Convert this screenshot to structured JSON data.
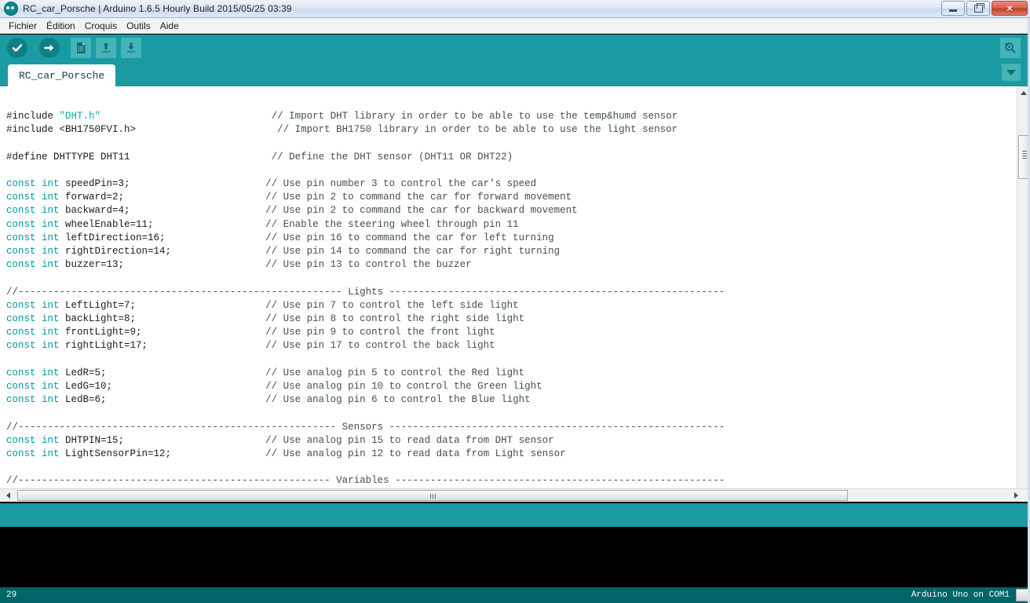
{
  "window": {
    "title": "RC_car_Porsche | Arduino 1.6.5 Hourly Build 2015/05/25 03:39",
    "logo_icon": "arduino-infinity-icon",
    "minimize_icon": "minimize-icon",
    "maximize_icon": "maximize-restore-icon",
    "close_icon": "close-icon",
    "close_glyph": "×"
  },
  "menu": {
    "items": [
      {
        "label": "Fichier"
      },
      {
        "label": "Édition"
      },
      {
        "label": "Croquis"
      },
      {
        "label": "Outils"
      },
      {
        "label": "Aide"
      }
    ]
  },
  "toolbar": {
    "verify_label": "Vérifier",
    "upload_label": "Téléverser",
    "new_label": "Nouveau",
    "open_label": "Ouvrir",
    "save_label": "Enregistrer",
    "serial_monitor_label": "Moniteur série",
    "icons": [
      "check-icon",
      "arrow-right-icon",
      "new-file-icon",
      "open-folder-icon",
      "save-icon",
      "serial-monitor-icon"
    ]
  },
  "tabs": {
    "active": "RC_car_Porsche",
    "items": [
      {
        "label": "RC_car_Porsche"
      }
    ],
    "dropdown_icon": "chevron-down-icon"
  },
  "editor": {
    "lines": [
      [
        {
          "t": "pre",
          "v": "#include "
        },
        {
          "t": "str",
          "v": "\"DHT.h\""
        },
        {
          "t": "pre",
          "v": "                             "
        },
        {
          "t": "cm",
          "v": "// Import DHT library in order to be able to use the temp&humd sensor"
        }
      ],
      [
        {
          "t": "pre",
          "v": "#include <BH1750FVI.h>"
        },
        {
          "t": "pre",
          "v": "                        "
        },
        {
          "t": "cm",
          "v": "// Import BH1750 library in order to be able to use the light sensor"
        }
      ],
      [
        {
          "t": "pre",
          "v": ""
        }
      ],
      [
        {
          "t": "pre",
          "v": "#define DHTTYPE DHT11"
        },
        {
          "t": "pre",
          "v": "                        "
        },
        {
          "t": "cm",
          "v": "// Define the DHT sensor (DHT11 OR DHT22)"
        }
      ],
      [
        {
          "t": "pre",
          "v": ""
        }
      ],
      [
        {
          "t": "kw",
          "v": "const int"
        },
        {
          "t": "pre",
          "v": " speedPin=3;"
        },
        {
          "t": "pre",
          "v": "                       "
        },
        {
          "t": "cm",
          "v": "// Use pin number 3 to control the car's speed"
        }
      ],
      [
        {
          "t": "kw",
          "v": "const int"
        },
        {
          "t": "pre",
          "v": " forward=2;"
        },
        {
          "t": "pre",
          "v": "                        "
        },
        {
          "t": "cm",
          "v": "// Use pin 2 to command the car for forward movement"
        }
      ],
      [
        {
          "t": "kw",
          "v": "const int"
        },
        {
          "t": "pre",
          "v": " backward=4;"
        },
        {
          "t": "pre",
          "v": "                       "
        },
        {
          "t": "cm",
          "v": "// Use pin 2 to command the car for backward movement"
        }
      ],
      [
        {
          "t": "kw",
          "v": "const int"
        },
        {
          "t": "pre",
          "v": " wheelEnable=11;"
        },
        {
          "t": "pre",
          "v": "                   "
        },
        {
          "t": "cm",
          "v": "// Enable the steering wheel through pin 11"
        }
      ],
      [
        {
          "t": "kw",
          "v": "const int"
        },
        {
          "t": "pre",
          "v": " leftDirection=16;"
        },
        {
          "t": "pre",
          "v": "                 "
        },
        {
          "t": "cm",
          "v": "// Use pin 16 to command the car for left turning"
        }
      ],
      [
        {
          "t": "kw",
          "v": "const int"
        },
        {
          "t": "pre",
          "v": " rightDirection=14;"
        },
        {
          "t": "pre",
          "v": "                "
        },
        {
          "t": "cm",
          "v": "// Use pin 14 to command the car for right turning"
        }
      ],
      [
        {
          "t": "kw",
          "v": "const int"
        },
        {
          "t": "pre",
          "v": " buzzer=13;"
        },
        {
          "t": "pre",
          "v": "                        "
        },
        {
          "t": "cm",
          "v": "// Use pin 13 to control the buzzer"
        }
      ],
      [
        {
          "t": "pre",
          "v": ""
        }
      ],
      [
        {
          "t": "cm",
          "v": "//------------------------------------------------------- Lights ---------------------------------------------------------"
        }
      ],
      [
        {
          "t": "kw",
          "v": "const int"
        },
        {
          "t": "pre",
          "v": " LeftLight=7;"
        },
        {
          "t": "pre",
          "v": "                      "
        },
        {
          "t": "cm",
          "v": "// Use pin 7 to control the left side light"
        }
      ],
      [
        {
          "t": "kw",
          "v": "const int"
        },
        {
          "t": "pre",
          "v": " backLight=8;"
        },
        {
          "t": "pre",
          "v": "                      "
        },
        {
          "t": "cm",
          "v": "// Use pin 8 to control the right side light"
        }
      ],
      [
        {
          "t": "kw",
          "v": "const int"
        },
        {
          "t": "pre",
          "v": " frontLight=9;"
        },
        {
          "t": "pre",
          "v": "                     "
        },
        {
          "t": "cm",
          "v": "// Use pin 9 to control the front light"
        }
      ],
      [
        {
          "t": "kw",
          "v": "const int"
        },
        {
          "t": "pre",
          "v": " rightLight=17;"
        },
        {
          "t": "pre",
          "v": "                    "
        },
        {
          "t": "cm",
          "v": "// Use pin 17 to control the back light"
        }
      ],
      [
        {
          "t": "pre",
          "v": ""
        }
      ],
      [
        {
          "t": "kw",
          "v": "const int"
        },
        {
          "t": "pre",
          "v": " LedR=5;"
        },
        {
          "t": "pre",
          "v": "                           "
        },
        {
          "t": "cm",
          "v": "// Use analog pin 5 to control the Red light"
        }
      ],
      [
        {
          "t": "kw",
          "v": "const int"
        },
        {
          "t": "pre",
          "v": " LedG=10;"
        },
        {
          "t": "pre",
          "v": "                          "
        },
        {
          "t": "cm",
          "v": "// Use analog pin 10 to control the Green light"
        }
      ],
      [
        {
          "t": "kw",
          "v": "const int"
        },
        {
          "t": "pre",
          "v": " LedB=6;"
        },
        {
          "t": "pre",
          "v": "                           "
        },
        {
          "t": "cm",
          "v": "// Use analog pin 6 to control the Blue light"
        }
      ],
      [
        {
          "t": "pre",
          "v": ""
        }
      ],
      [
        {
          "t": "cm",
          "v": "//------------------------------------------------------ Sensors ---------------------------------------------------------"
        }
      ],
      [
        {
          "t": "kw",
          "v": "const int"
        },
        {
          "t": "pre",
          "v": " DHTPIN=15;"
        },
        {
          "t": "pre",
          "v": "                        "
        },
        {
          "t": "cm",
          "v": "// Use analog pin 15 to read data from DHT sensor"
        }
      ],
      [
        {
          "t": "kw",
          "v": "const int"
        },
        {
          "t": "pre",
          "v": " LightSensorPin=12;"
        },
        {
          "t": "pre",
          "v": "                "
        },
        {
          "t": "cm",
          "v": "// Use analog pin 12 to read data from Light sensor"
        }
      ],
      [
        {
          "t": "pre",
          "v": ""
        }
      ],
      [
        {
          "t": "cm",
          "v": "//----------------------------------------------------- Variables --------------------------------------------------------"
        }
      ]
    ]
  },
  "scrollbars": {
    "vertical_up_icon": "triangle-up-icon",
    "vertical_down_icon": "triangle-down-icon",
    "horizontal_left_icon": "triangle-left-icon",
    "horizontal_right_icon": "triangle-right-icon"
  },
  "console": {
    "text": ""
  },
  "status": {
    "line_number": "29",
    "board": "Arduino Uno on COM1"
  },
  "colors": {
    "accent_teal": "#1a9ba1",
    "dark_teal": "#006468",
    "toolbar_icon_bg": "#45b3b7",
    "keyword": "#00979c",
    "string": "#0aa8b0",
    "comment": "#434f54",
    "console_bg": "#000000"
  }
}
